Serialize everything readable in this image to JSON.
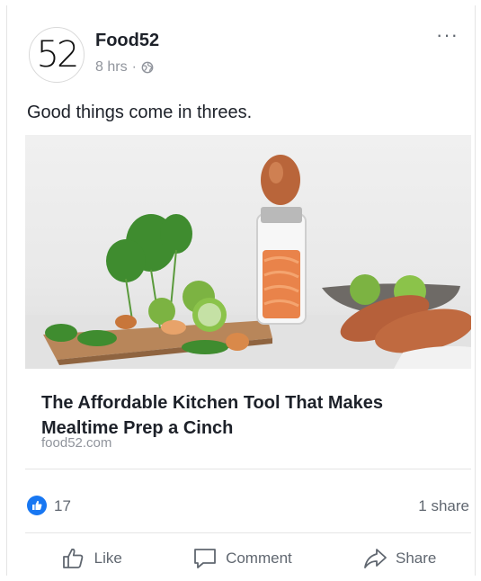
{
  "post": {
    "page_name": "Food52",
    "avatar_text": "52",
    "time": "8 hrs",
    "separator": "·",
    "privacy_icon": "globe-icon",
    "more_label": "···",
    "text": "Good things come in threes."
  },
  "link": {
    "title": "The Affordable Kitchen Tool That Makes Mealtime Prep a Cinch",
    "domain": "food52.com"
  },
  "reactions": {
    "like_count": "17",
    "share_count": "1 share",
    "badge_color": "#1877f2"
  },
  "actions": {
    "like": "Like",
    "comment": "Comment",
    "share": "Share"
  }
}
